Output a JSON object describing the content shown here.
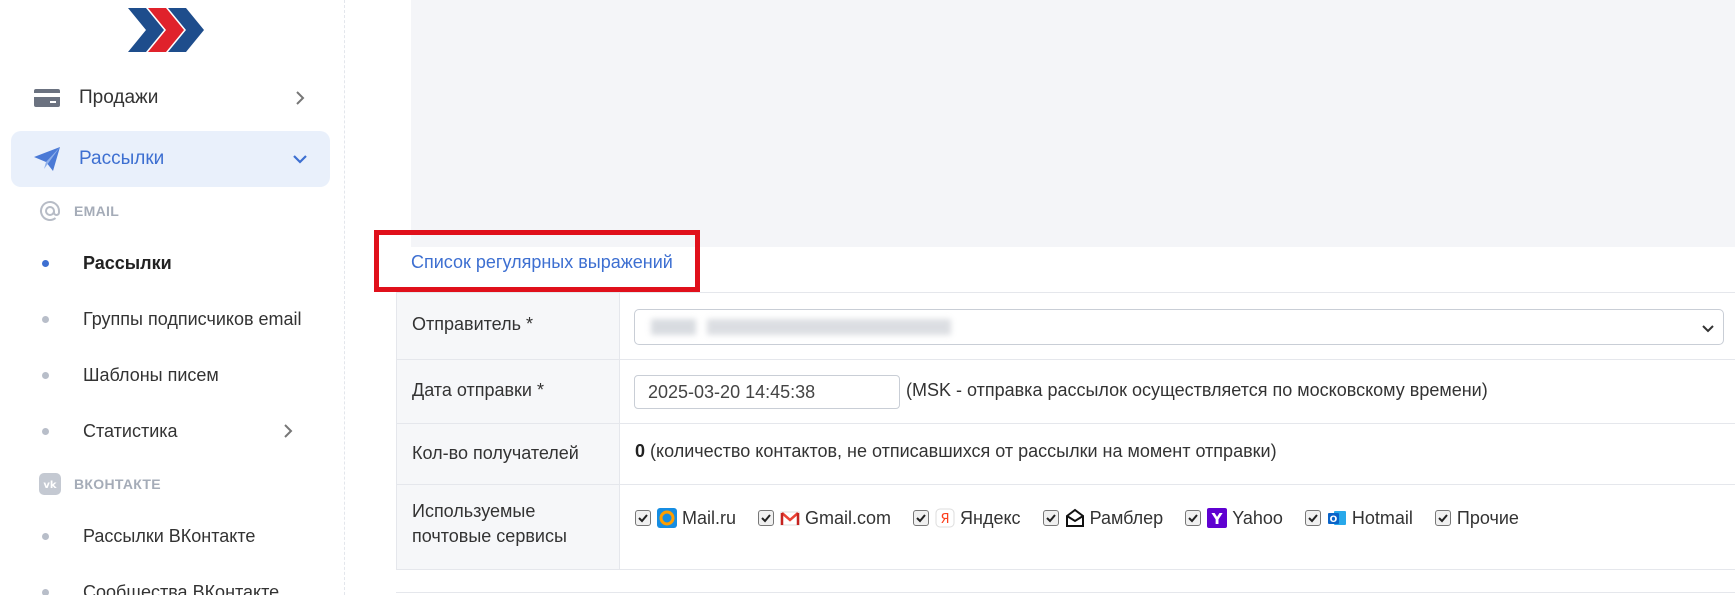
{
  "sidebar": {
    "items": [
      {
        "label": "Продажи"
      },
      {
        "label": "Рассылки"
      }
    ],
    "sections": [
      {
        "label": "EMAIL"
      },
      {
        "label": "ВКОНТАКТЕ"
      }
    ],
    "email_sub": [
      {
        "label": "Рассылки"
      },
      {
        "label": "Группы подписчиков email"
      },
      {
        "label": "Шаблоны писем"
      },
      {
        "label": "Статистика"
      }
    ],
    "vk_sub": [
      {
        "label": "Рассылки ВКонтакте"
      },
      {
        "label": "Сообщества ВКонтакте"
      }
    ]
  },
  "main": {
    "regex_link": "Список регулярных выражений",
    "form": {
      "sender_label": "Отправитель *",
      "date_label": "Дата отправки *",
      "date_value": "2025-03-20 14:45:38",
      "date_note": "(MSK - отправка рассылок осуществляется по московскому времени)",
      "count_label": "Кол-во получателей",
      "count_value": "0",
      "count_note": "(количество контактов, не отписавшихся от рассылки на момент отправки)",
      "services_label_line1": "Используемые",
      "services_label_line2": "почтовые сервисы",
      "services": [
        {
          "label": "Mail.ru",
          "icon": "mailru-icon"
        },
        {
          "label": "Gmail.com",
          "icon": "gmail-icon"
        },
        {
          "label": "Яндекс",
          "icon": "yandex-icon"
        },
        {
          "label": "Рамблер",
          "icon": "rambler-icon"
        },
        {
          "label": "Yahoo",
          "icon": "yahoo-icon"
        },
        {
          "label": "Hotmail",
          "icon": "hotmail-icon"
        },
        {
          "label": "Прочие",
          "icon": ""
        }
      ]
    }
  },
  "colors": {
    "accent": "#3d6fd1",
    "highlight": "#e0101b",
    "active_bg": "#e9f0fb"
  }
}
